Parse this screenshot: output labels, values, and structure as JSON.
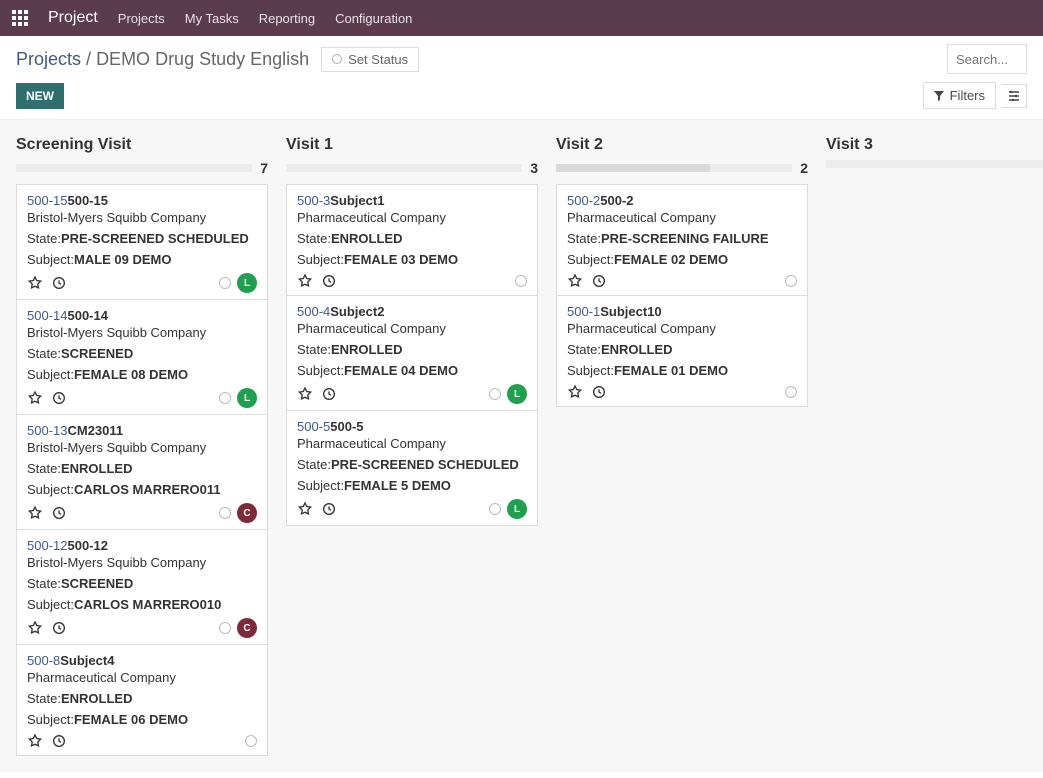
{
  "topbar": {
    "brand": "Project",
    "items": [
      "Projects",
      "My Tasks",
      "Reporting",
      "Configuration"
    ]
  },
  "breadcrumb": {
    "parent": "Projects",
    "child": "DEMO Drug Study English"
  },
  "set_status": "Set Status",
  "search_placeholder": "Search...",
  "new_button": "NEW",
  "filters_button": "Filters",
  "state_label_prefix": "State:",
  "subject_label_prefix": "Subject:",
  "columns": [
    {
      "title": "Screening Visit",
      "count": "7",
      "fill_pct": 0,
      "cards": [
        {
          "code": "500-15",
          "name": "500-15",
          "company": "Bristol-Myers Squibb Company",
          "state": "PRE-SCREENED SCHEDULED",
          "subject": "MALE 09 DEMO",
          "avatar": {
            "letter": "L",
            "color": "green"
          }
        },
        {
          "code": "500-14",
          "name": "500-14",
          "company": "Bristol-Myers Squibb Company",
          "state": "SCREENED",
          "subject": "FEMALE 08 DEMO",
          "avatar": {
            "letter": "L",
            "color": "green"
          }
        },
        {
          "code": "500-13",
          "name": "CM23011",
          "company": "Bristol-Myers Squibb Company",
          "state": "ENROLLED",
          "subject": "CARLOS MARRERO011",
          "avatar": {
            "letter": "C",
            "color": "maroon"
          }
        },
        {
          "code": "500-12",
          "name": "500-12",
          "company": "Bristol-Myers Squibb Company",
          "state": "SCREENED",
          "subject": "CARLOS MARRERO010",
          "avatar": {
            "letter": "C",
            "color": "maroon"
          }
        },
        {
          "code": "500-8",
          "name": "Subject4",
          "company": "Pharmaceutical Company",
          "state": "ENROLLED",
          "subject": "FEMALE 06 DEMO",
          "avatar": null
        }
      ]
    },
    {
      "title": "Visit 1",
      "count": "3",
      "fill_pct": 0,
      "cards": [
        {
          "code": "500-3",
          "name": "Subject1",
          "company": "Pharmaceutical Company",
          "state": "ENROLLED",
          "subject": "FEMALE 03 DEMO",
          "avatar": null
        },
        {
          "code": "500-4",
          "name": "Subject2",
          "company": "Pharmaceutical Company",
          "state": "ENROLLED",
          "subject": "FEMALE 04 DEMO",
          "avatar": {
            "letter": "L",
            "color": "green"
          }
        },
        {
          "code": "500-5",
          "name": "500-5",
          "company": "Pharmaceutical Company",
          "state": "PRE-SCREENED SCHEDULED",
          "subject": "FEMALE 5 DEMO",
          "avatar": {
            "letter": "L",
            "color": "green"
          }
        }
      ]
    },
    {
      "title": "Visit 2",
      "count": "2",
      "fill_pct": 65,
      "cards": [
        {
          "code": "500-2",
          "name": "500-2",
          "company": "Pharmaceutical Company",
          "state": "PRE-SCREENING FAILURE",
          "subject": "FEMALE 02 DEMO",
          "avatar": null
        },
        {
          "code": "500-1",
          "name": "Subject10",
          "company": "Pharmaceutical Company",
          "state": "ENROLLED",
          "subject": "FEMALE 01 DEMO",
          "avatar": null
        }
      ]
    },
    {
      "title": "Visit 3",
      "count": "",
      "fill_pct": 0,
      "cards": []
    }
  ]
}
